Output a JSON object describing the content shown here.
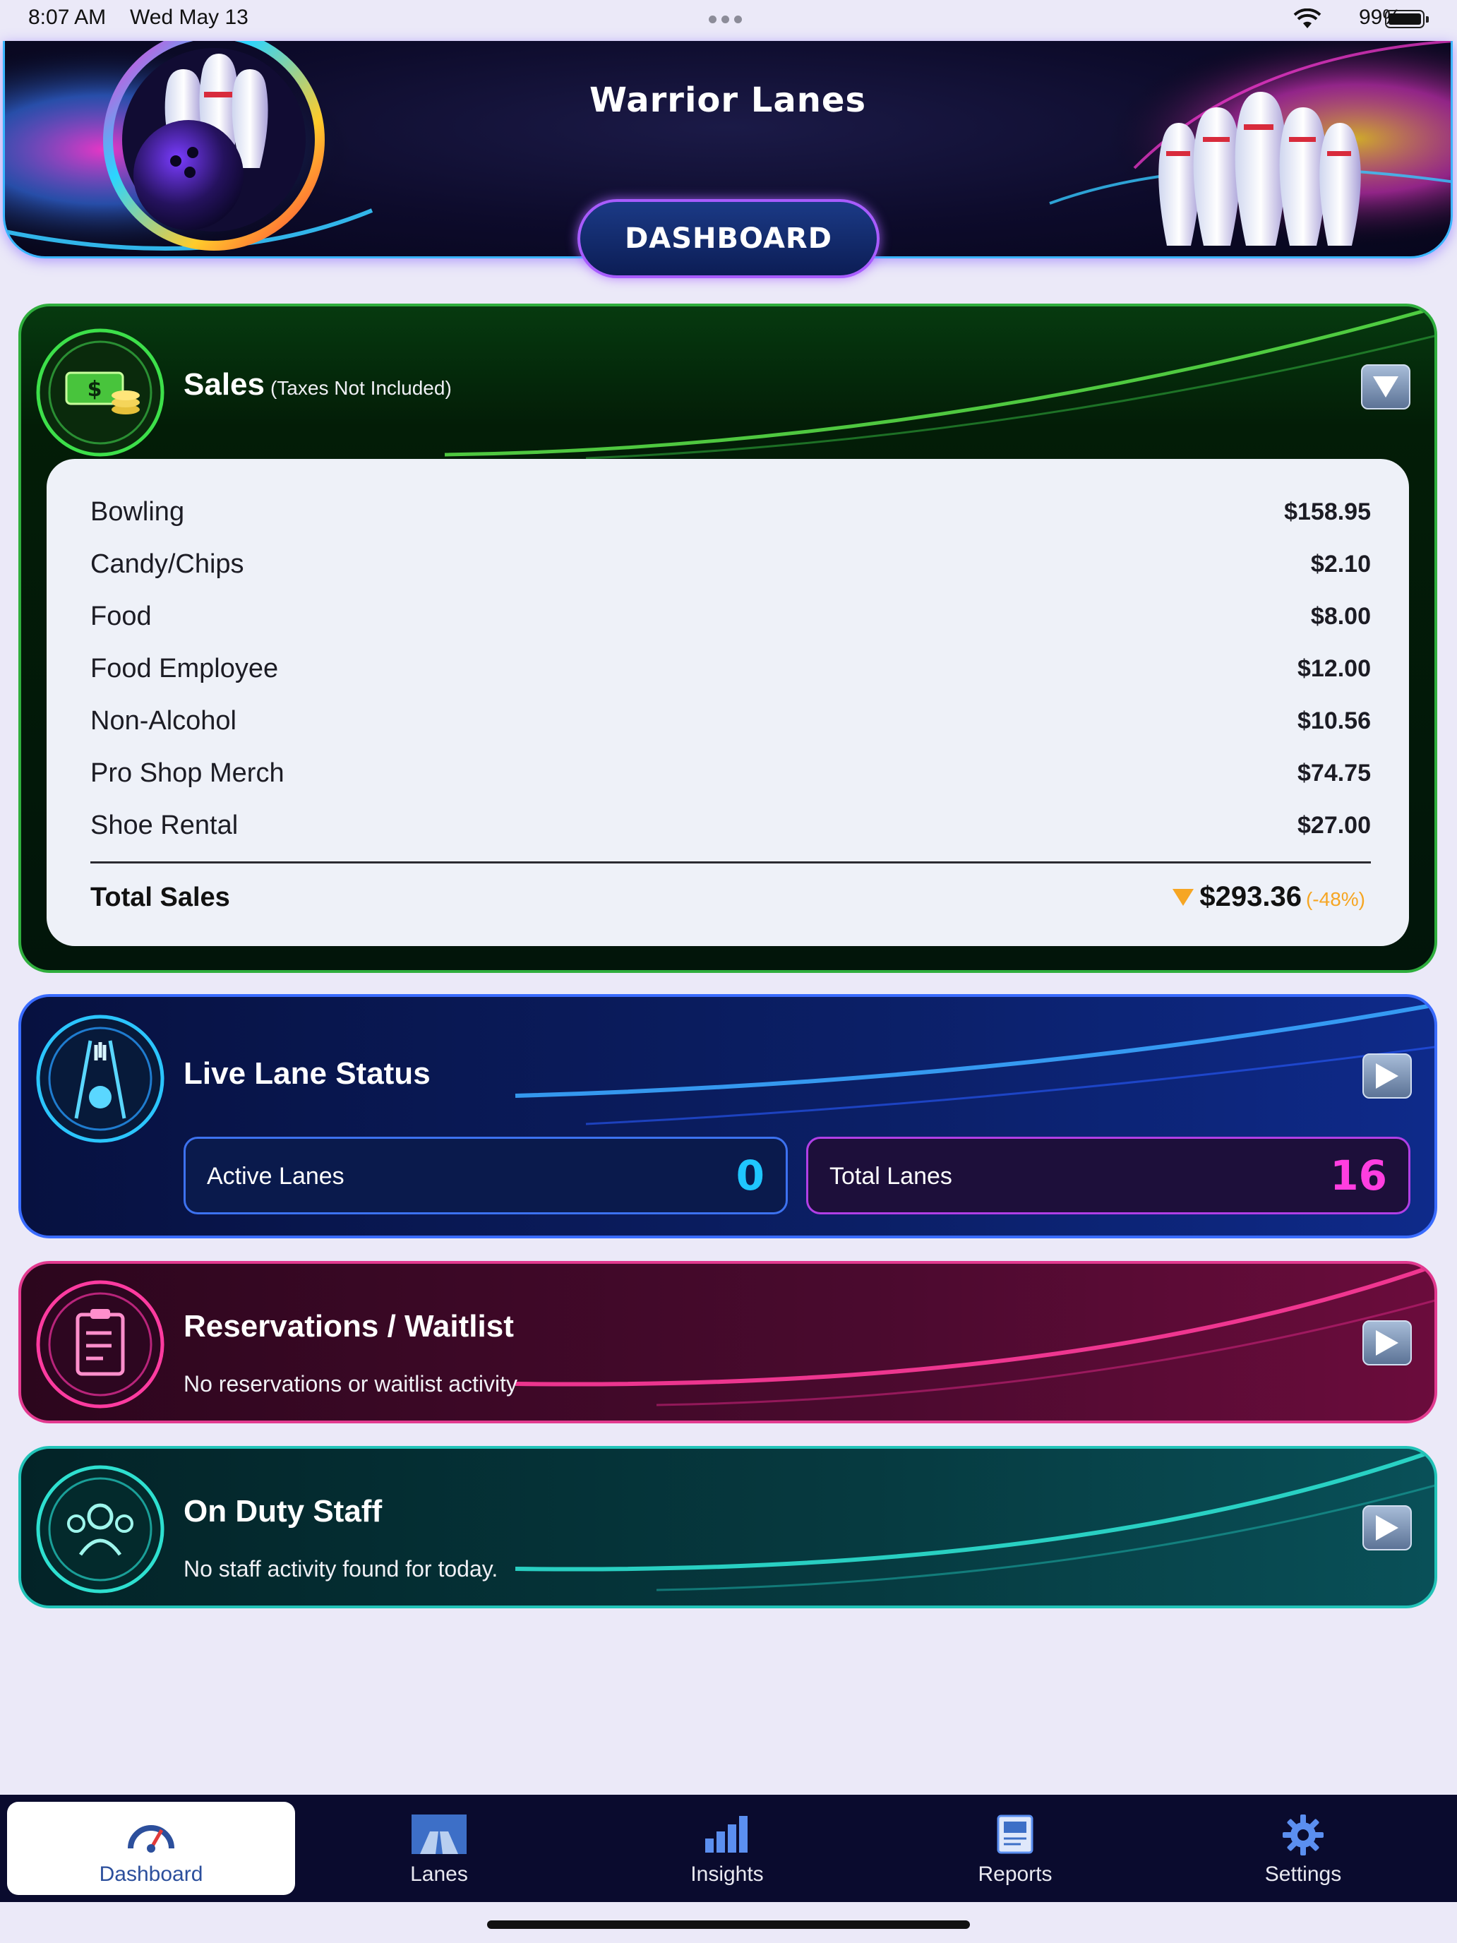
{
  "status_bar": {
    "time": "8:07 AM",
    "date": "Wed May 13",
    "battery": "99%"
  },
  "header": {
    "title": "Warrior Lanes",
    "section_button": "DASHBOARD"
  },
  "sales": {
    "title": "Sales",
    "note": "(Taxes Not Included)",
    "items": [
      {
        "label": "Bowling",
        "value": "$158.95"
      },
      {
        "label": "Candy/Chips",
        "value": "$2.10"
      },
      {
        "label": "Food",
        "value": "$8.00"
      },
      {
        "label": "Food Employee",
        "value": "$12.00"
      },
      {
        "label": "Non-Alcohol",
        "value": "$10.56"
      },
      {
        "label": "Pro Shop Merch",
        "value": "$74.75"
      },
      {
        "label": "Shoe Rental",
        "value": "$27.00"
      }
    ],
    "total_label": "Total Sales",
    "total_value": "$293.36",
    "total_change": "(-48%)",
    "change_color": "#f6a623"
  },
  "lanes": {
    "title": "Live Lane Status",
    "active_label": "Active Lanes",
    "active_value": "0",
    "total_label": "Total Lanes",
    "total_value": "16"
  },
  "reservations": {
    "title": "Reservations / Waitlist",
    "message": "No reservations or waitlist activity"
  },
  "staff": {
    "title": "On Duty Staff",
    "message": "No staff activity found for today."
  },
  "tabs": [
    {
      "label": "Dashboard",
      "icon": "speedometer-icon",
      "active": true
    },
    {
      "label": "Lanes",
      "icon": "lanes-icon",
      "active": false
    },
    {
      "label": "Insights",
      "icon": "bar-chart-icon",
      "active": false
    },
    {
      "label": "Reports",
      "icon": "report-icon",
      "active": false
    },
    {
      "label": "Settings",
      "icon": "gear-icon",
      "active": false
    }
  ],
  "colors": {
    "sales_accent": "#2fae3d",
    "lanes_accent": "#3a6cff",
    "reservations_accent": "#e23a8f",
    "staff_accent": "#22c3b8",
    "active_lanes_value": "#1fc6ff",
    "total_lanes_value": "#ff3ee0"
  }
}
